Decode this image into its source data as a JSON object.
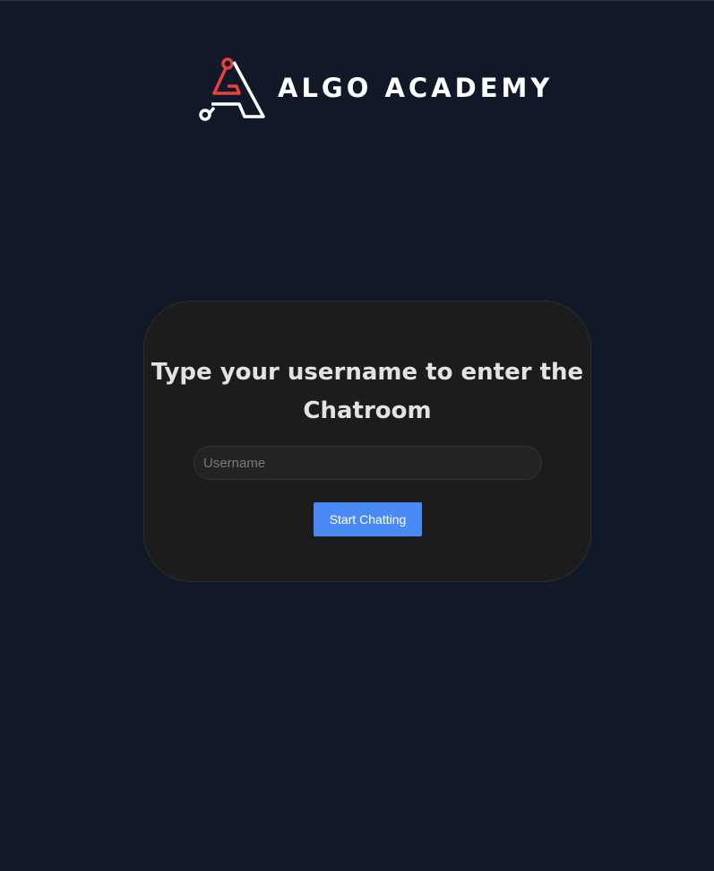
{
  "brand": {
    "name": "ALGO ACADEMY",
    "logo_icon": "algo-academy-logo-icon",
    "colors": {
      "accent_red": "#e8403f",
      "white": "#ffffff"
    }
  },
  "login_card": {
    "title": "Type your username to enter the Chatroom",
    "username_placeholder": "Username",
    "username_value": "",
    "submit_label": "Start Chatting"
  },
  "colors": {
    "page_background": "#111827",
    "card_background": "#1c1c1c",
    "button_background": "#4a8af4"
  }
}
